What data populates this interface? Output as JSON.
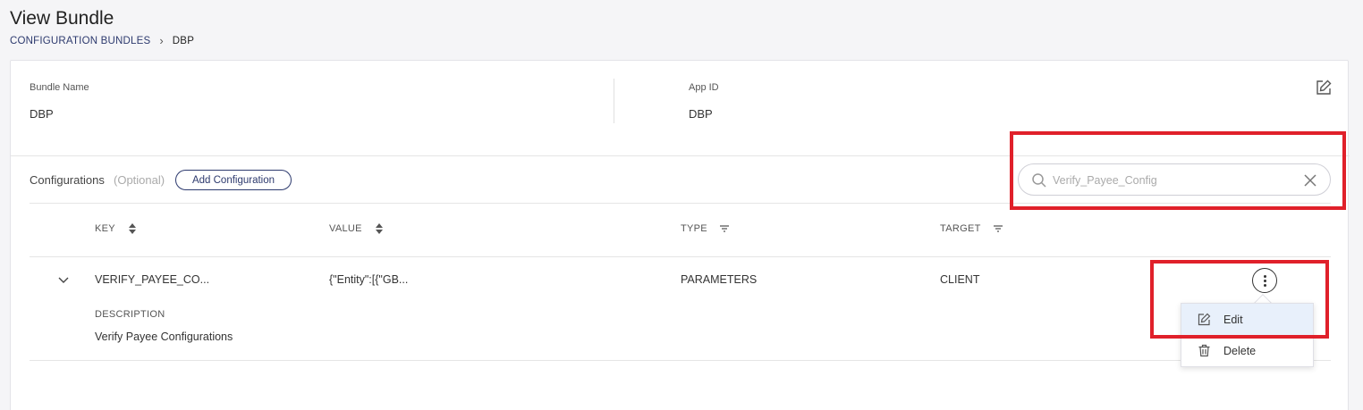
{
  "page": {
    "title": "View Bundle"
  },
  "breadcrumb": {
    "root": "CONFIGURATION BUNDLES",
    "separator": "›",
    "current": "DBP"
  },
  "bundle": {
    "name_label": "Bundle Name",
    "name_value": "DBP",
    "appid_label": "App ID",
    "appid_value": "DBP"
  },
  "configurations": {
    "label": "Configurations",
    "optional": "(Optional)",
    "add_button": "Add Configuration"
  },
  "search": {
    "value": "Verify_Payee_Config",
    "placeholder": "Verify_Payee_Config"
  },
  "table": {
    "columns": [
      {
        "label": "KEY",
        "icon": "sort-icon"
      },
      {
        "label": "VALUE",
        "icon": "sort-icon"
      },
      {
        "label": "TYPE",
        "icon": "filter-icon"
      },
      {
        "label": "TARGET",
        "icon": "filter-icon"
      }
    ],
    "rows": [
      {
        "key": "VERIFY_PAYEE_CO...",
        "value": "{\"Entity\":[{\"GB...",
        "type": "PARAMETERS",
        "target": "CLIENT",
        "description_label": "DESCRIPTION",
        "description": "Verify Payee Configurations"
      }
    ]
  },
  "row_menu": {
    "items": [
      {
        "label": "Edit",
        "icon": "edit-icon"
      },
      {
        "label": "Delete",
        "icon": "trash-icon"
      }
    ]
  },
  "colors": {
    "accent": "#2d3a6e",
    "highlight": "#e0202a",
    "menu_active": "#e8f0fb"
  }
}
